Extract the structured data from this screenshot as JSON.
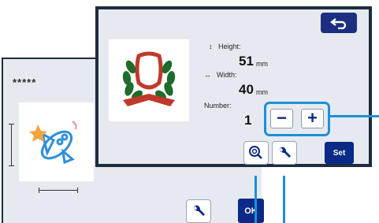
{
  "back_screen": {
    "title_masked": "*****",
    "wrench_icon": "wrench-icon",
    "ok_label": "OK"
  },
  "front_screen": {
    "height_label": "Height:",
    "height_value": "51",
    "height_unit": "mm",
    "width_label": "Width:",
    "width_value": "40",
    "width_unit": "mm",
    "number_label": "Number:",
    "number_value": "1",
    "minus_label": "−",
    "plus_label": "+",
    "set_label": "Set",
    "icons": [
      "back-arrow-icon",
      "zoom-icon",
      "wrench-icon"
    ]
  },
  "colors": {
    "panel_bg": "#e6eaf0",
    "frame": "#1e2c3f",
    "primary_button": "#0b2a87",
    "callout": "#1f8fd8"
  }
}
